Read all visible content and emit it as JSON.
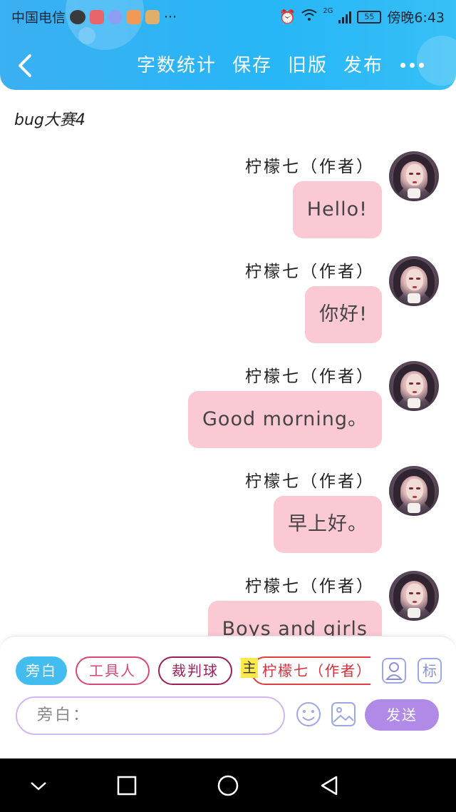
{
  "status_bar": {
    "carrier": "中国电信",
    "overflow": "···",
    "network": "2G",
    "battery": "55",
    "time": "傍晚6:43"
  },
  "header": {
    "back_icon": "chevron-left",
    "actions": {
      "word_count": "字数统计",
      "save": "保存",
      "old_version": "旧版",
      "publish": "发布"
    },
    "more_icon": "three-dots"
  },
  "doc_title": "bug大赛4",
  "messages": [
    {
      "author": "柠檬七（作者）",
      "text": "Hello!"
    },
    {
      "author": "柠檬七（作者）",
      "text": "你好!"
    },
    {
      "author": "柠檬七（作者）",
      "text": "Good morning。"
    },
    {
      "author": "柠檬七（作者）",
      "text": "早上好。"
    },
    {
      "author": "柠檬七（作者）",
      "text": "Boys and girls"
    }
  ],
  "composer": {
    "roles": {
      "narration": "旁白",
      "tool_person": "工具人",
      "referee": "裁判球",
      "main_badge": "主",
      "author": "柠檬七（作者）"
    },
    "tag_label": "标",
    "input_placeholder": "旁白：",
    "send": "发送"
  },
  "colors": {
    "header_blue": "#27b6f7",
    "bubble_pink": "#fbc9d4",
    "send_purple": "#b18ae8",
    "narration_blue": "#43bdf0"
  }
}
